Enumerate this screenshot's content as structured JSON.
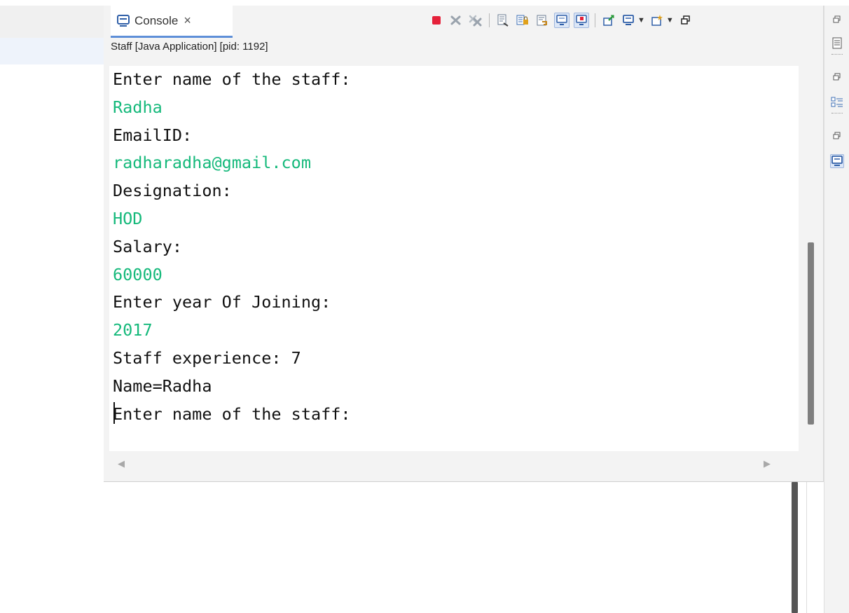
{
  "console": {
    "tab_label": "Console",
    "close_glyph": "×",
    "process_label": "Staff [Java Application]  [pid: 1192]",
    "lines": [
      {
        "text": "Enter name of the staff:",
        "kind": "out"
      },
      {
        "text": "Radha",
        "kind": "in"
      },
      {
        "text": "EmailID:",
        "kind": "out"
      },
      {
        "text": "radharadha@gmail.com",
        "kind": "in"
      },
      {
        "text": "Designation:",
        "kind": "out"
      },
      {
        "text": "HOD",
        "kind": "in"
      },
      {
        "text": "Salary:",
        "kind": "out"
      },
      {
        "text": "60000",
        "kind": "in"
      },
      {
        "text": "Enter year Of Joining:",
        "kind": "out"
      },
      {
        "text": "2017",
        "kind": "in"
      },
      {
        "text": "Staff experience: 7",
        "kind": "out"
      },
      {
        "text": "Name=Radha",
        "kind": "out"
      },
      {
        "text": "Enter name of the staff:",
        "kind": "out"
      }
    ]
  },
  "toolbar": {
    "icons": [
      "terminate-icon",
      "remove-launch-icon",
      "remove-all-terminated-icon",
      "clear-console-icon",
      "scroll-lock-icon",
      "word-wrap-icon",
      "show-on-stdout-icon",
      "show-on-stderr-icon",
      "pin-console-icon",
      "display-selected-console-icon",
      "open-console-icon",
      "minimize-icon"
    ]
  },
  "colors": {
    "output_text": "#111111",
    "input_text": "#15b97b",
    "tab_underline": "#5e8fd8",
    "terminate_red": "#e5213a"
  }
}
